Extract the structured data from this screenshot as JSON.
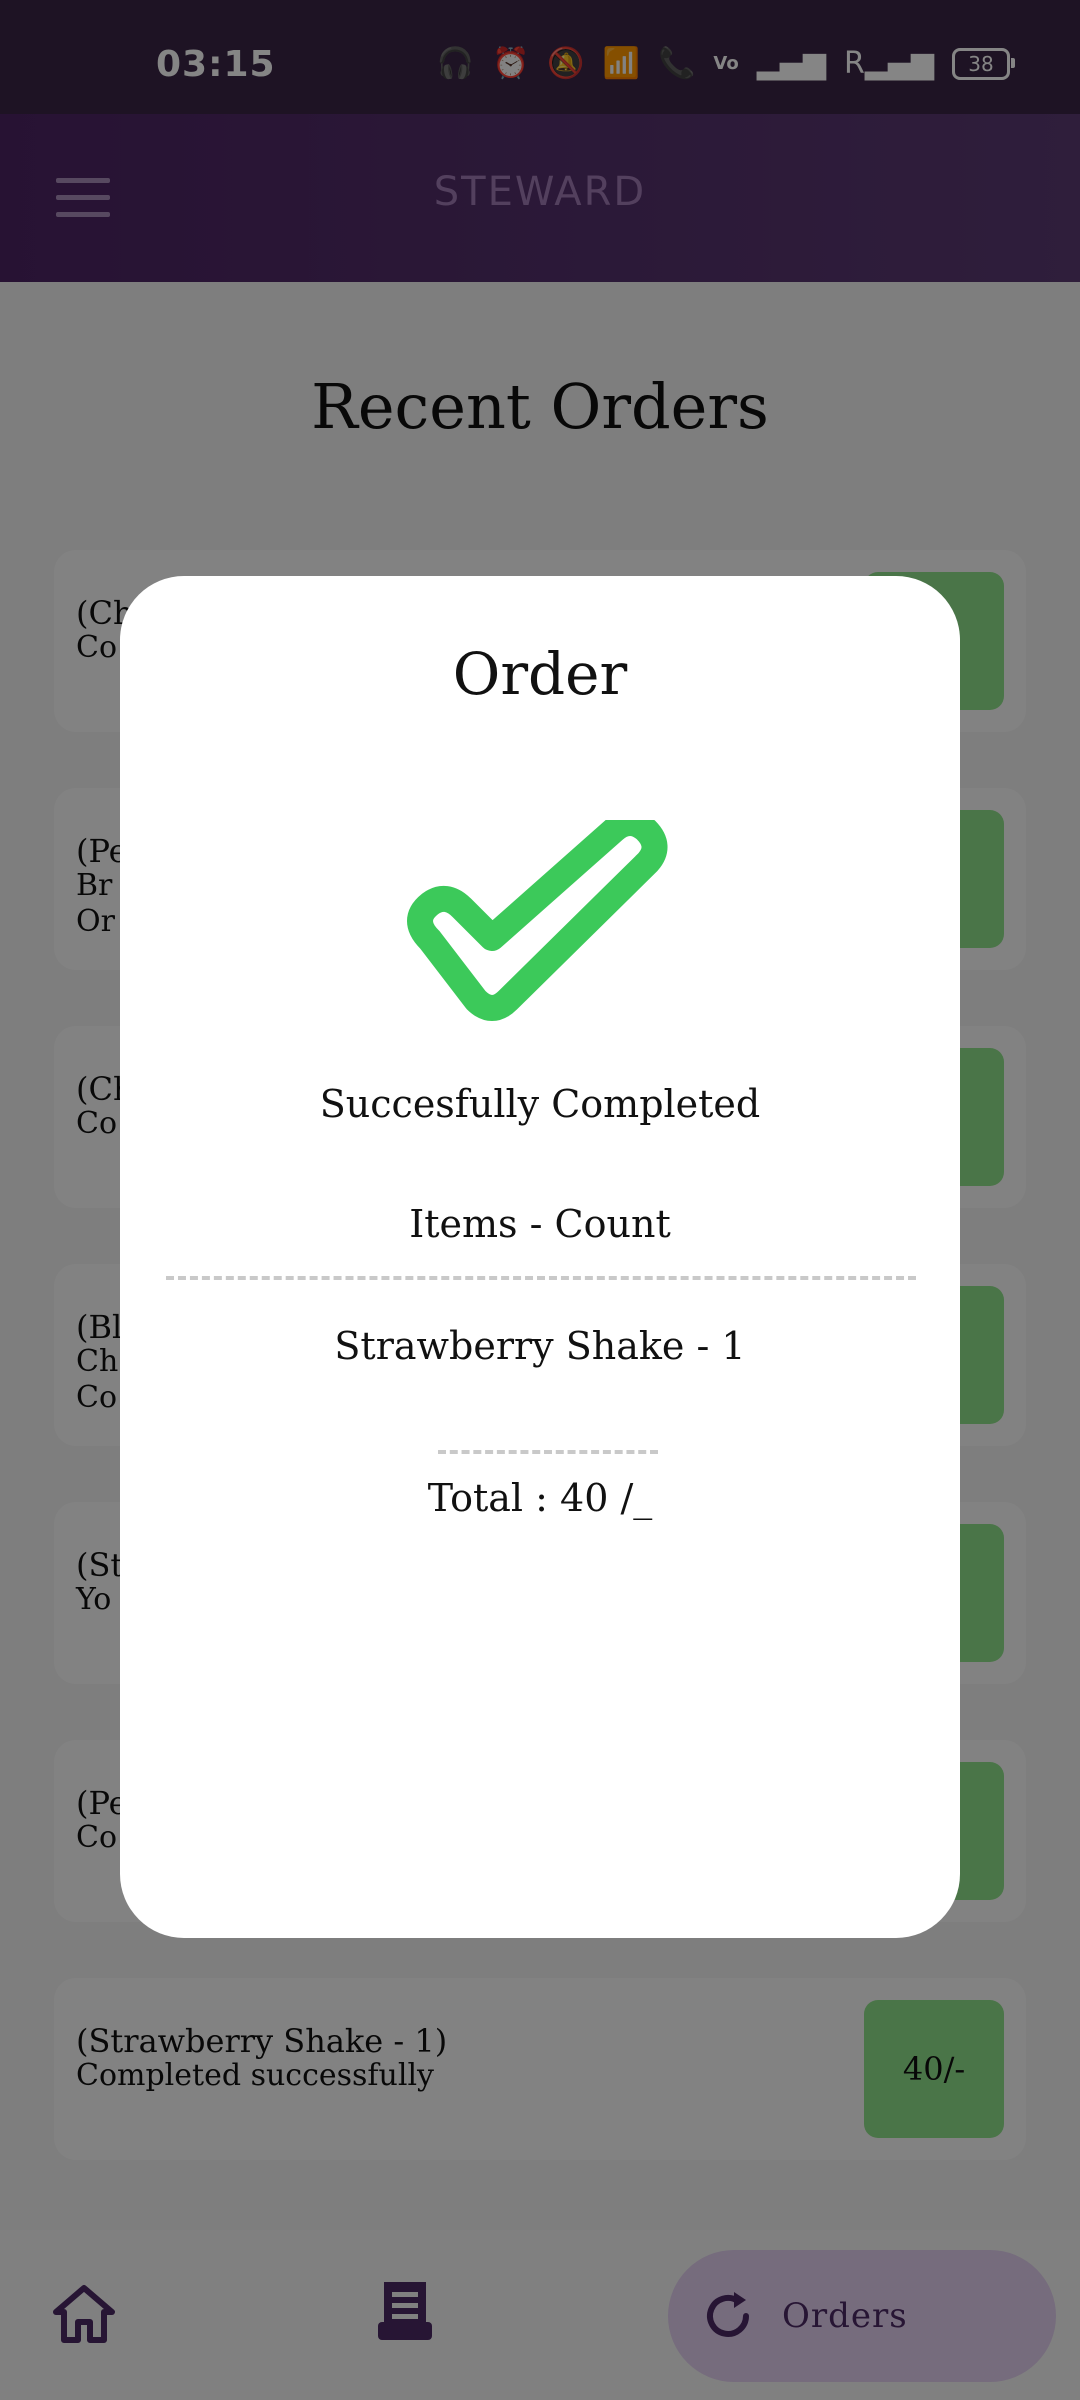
{
  "status_bar": {
    "time": "03:15",
    "battery": "38",
    "icons": [
      "headphones-icon",
      "alarm-icon",
      "bell-off-icon",
      "wifi-icon",
      "wifi-call-icon",
      "volte-icon",
      "signal-icon",
      "signal-roaming-icon",
      "battery-icon"
    ]
  },
  "app_bar": {
    "title": "STEWARD",
    "menu_icon": "hamburger-menu-icon"
  },
  "page": {
    "title": "Recent Orders"
  },
  "orders": [
    {
      "line1": "(Ch",
      "line2": "Co",
      "price": "-"
    },
    {
      "line1": "(Pe",
      "line2": "Br",
      "line3": "Or",
      "price": "/-"
    },
    {
      "line1": "(Ch",
      "line2": "Co",
      "price": "-"
    },
    {
      "line1": "(Bl",
      "line2": "Ch",
      "line3": "Co",
      "price": "-"
    },
    {
      "line1": "(St",
      "line2": "Yo",
      "price": "-"
    },
    {
      "line1": "(Pe",
      "line2": "Co",
      "price": "-"
    },
    {
      "line1": "(Strawberry Shake - 1)",
      "line2": "Completed successfully",
      "price": "40/-"
    }
  ],
  "modal": {
    "title": "Order",
    "icon": "check-icon",
    "status": "Succesfully Completed",
    "items_header": "Items - Count",
    "item_line": "Strawberry Shake - 1",
    "total": "Total : 40 /_"
  },
  "bottom_nav": {
    "home_icon": "home-icon",
    "receipt_icon": "receipt-icon",
    "orders_label": "Orders",
    "orders_icon": "refresh-icon"
  },
  "colors": {
    "app_bar": "#4c2463",
    "price_badge": "#8fe08a",
    "check": "#3cc95a",
    "nav_active": "#e2cff0",
    "nav_icon": "#4b2a64"
  }
}
